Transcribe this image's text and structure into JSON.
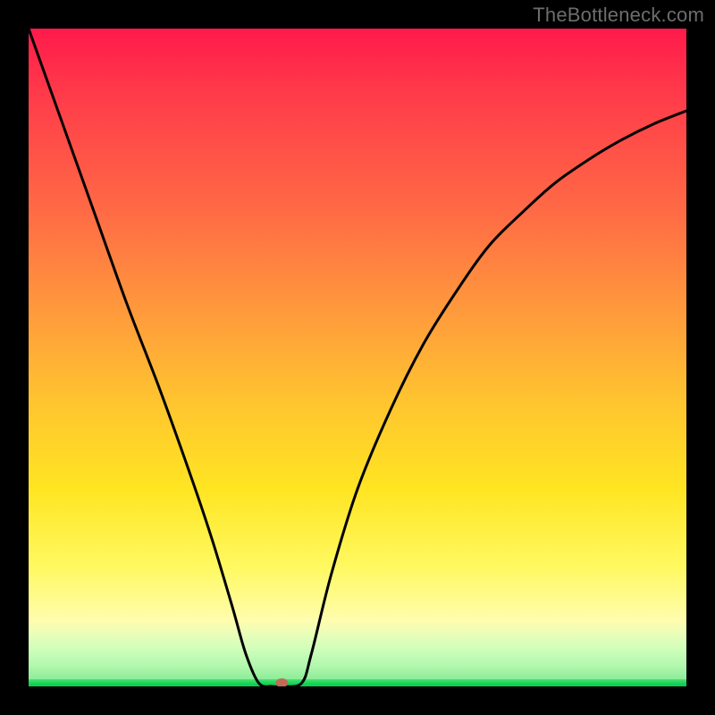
{
  "watermark": "TheBottleneck.com",
  "chart_data": {
    "type": "line",
    "title": "",
    "xlabel": "",
    "ylabel": "",
    "xlim": [
      0,
      100
    ],
    "ylim": [
      0,
      100
    ],
    "grid": false,
    "legend": false,
    "series": [
      {
        "name": "bottleneck-curve",
        "x": [
          0,
          5,
          10,
          15,
          20,
          25,
          28,
          31,
          33,
          35,
          37,
          38.5,
          41.5,
          43,
          46,
          50,
          55,
          60,
          65,
          70,
          75,
          80,
          85,
          90,
          95,
          100
        ],
        "values": [
          100,
          86,
          72,
          58,
          45,
          31,
          22,
          12,
          5,
          0.5,
          0,
          0,
          0.5,
          5,
          17,
          30,
          42,
          52,
          60,
          67,
          72,
          76.5,
          80,
          83,
          85.5,
          87.5
        ]
      }
    ],
    "marker": {
      "x": 38.5,
      "y": 0,
      "color": "#c16a57"
    },
    "background_gradient": {
      "stops": [
        {
          "pos": 0.0,
          "color": "#ff1a4b"
        },
        {
          "pos": 0.28,
          "color": "#ff6b45"
        },
        {
          "pos": 0.57,
          "color": "#ffc52f"
        },
        {
          "pos": 0.82,
          "color": "#fff962"
        },
        {
          "pos": 0.95,
          "color": "#ffffe2"
        },
        {
          "pos": 0.985,
          "color": "#4fe073"
        },
        {
          "pos": 1.0,
          "color": "#0acc4e"
        }
      ]
    }
  }
}
